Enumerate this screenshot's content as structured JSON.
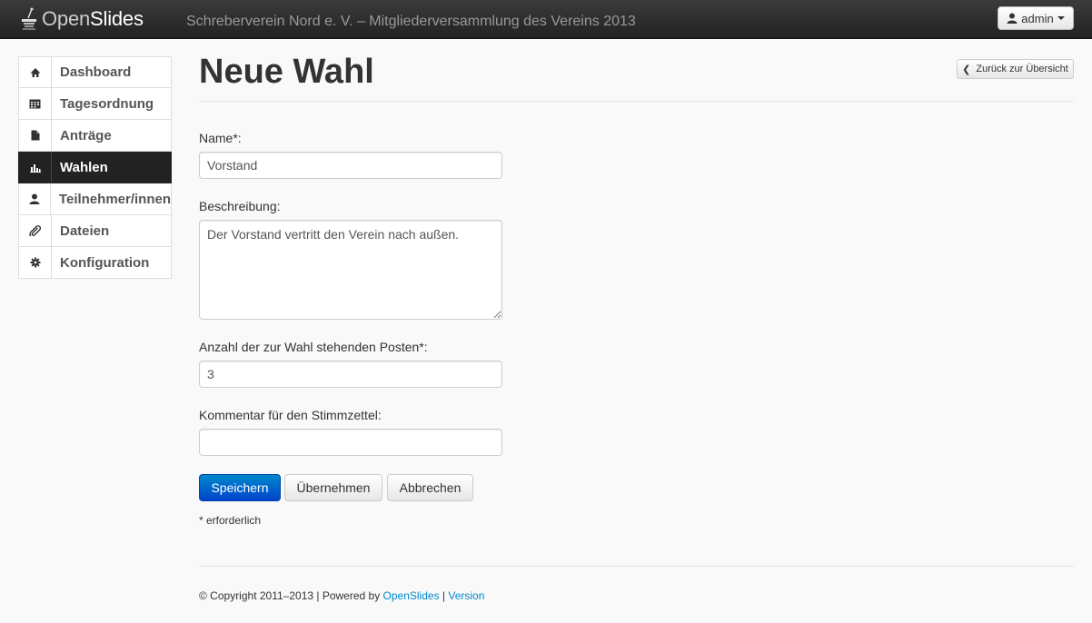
{
  "topbar": {
    "logo_light": "Open",
    "logo_bold": "Slides",
    "event_title": "Schreberverein Nord e. V. – Mitgliederversammlung des Vereins 2013",
    "user_label": "admin"
  },
  "sidebar": {
    "items": [
      {
        "label": "Dashboard",
        "icon": "home-icon",
        "active": false
      },
      {
        "label": "Tagesordnung",
        "icon": "calendar-icon",
        "active": false
      },
      {
        "label": "Anträge",
        "icon": "file-icon",
        "active": false
      },
      {
        "label": "Wahlen",
        "icon": "bar-chart-icon",
        "active": true
      },
      {
        "label": "Teilnehmer/innen",
        "icon": "user-icon",
        "active": false
      },
      {
        "label": "Dateien",
        "icon": "paperclip-icon",
        "active": false
      },
      {
        "label": "Konfiguration",
        "icon": "cog-icon",
        "active": false
      }
    ]
  },
  "main": {
    "title": "Neue Wahl",
    "back_label": "Zurück zur Übersicht",
    "form": {
      "name_label": "Name*:",
      "name_value": "Vorstand",
      "description_label": "Beschreibung:",
      "description_value": "Der Vorstand vertritt den Verein nach außen.",
      "posts_label": "Anzahl der zur Wahl stehenden Posten*:",
      "posts_value": "3",
      "comment_label": "Kommentar für den Stimmzettel:",
      "comment_value": ""
    },
    "buttons": {
      "save": "Speichern",
      "apply": "Übernehmen",
      "cancel": "Abbrechen"
    },
    "required_note": "* erforderlich"
  },
  "footer": {
    "copyright": "© Copyright 2011–2013 | Powered by ",
    "openslides_link": "OpenSlides",
    "separator": " | ",
    "version_link": "Version"
  },
  "colors": {
    "primary": "#0055cc",
    "link": "#0088cc",
    "active_nav": "#222222"
  }
}
